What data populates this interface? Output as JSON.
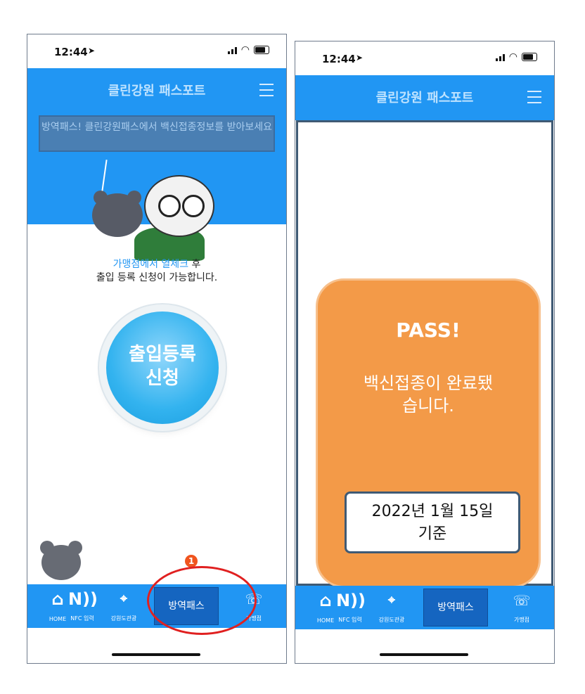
{
  "status": {
    "time": "12:44"
  },
  "app": {
    "title": "클린강원 패스포트"
  },
  "screen1": {
    "notice": "방역패스! 클린강원패스에서 백신접종정보를 받아보세요",
    "info_highlight": "가맹점에서 열체크",
    "info_after": " 후",
    "info_line2": "출입 등록 신청이 가능합니다.",
    "entry_button_line1": "출입등록",
    "entry_button_line2": "신청",
    "badge": "1"
  },
  "nav": {
    "home": "HOME",
    "nfc": "NFC 입력",
    "tour": "강원도관광",
    "vaccine_pass": "방역패스",
    "store": "가맹점"
  },
  "screen2": {
    "pass_title": "PASS!",
    "pass_message_line1": "백신접종이 완료됐",
    "pass_message_line2": "습니다.",
    "date_line1": "2022년 1월 15일",
    "date_line2": "기준"
  },
  "colors": {
    "primary": "#2196f3",
    "pass_orange": "#f39a48",
    "badge": "#f0541e",
    "dark_blue": "#1565c0"
  }
}
